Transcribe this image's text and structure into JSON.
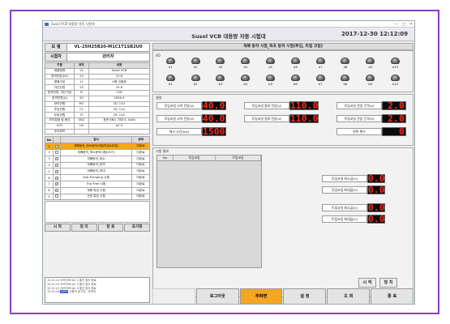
{
  "window": {
    "title": "Susol VCB 대용량 자동 시험대",
    "controls": [
      "—",
      "□",
      "✕"
    ]
  },
  "header": {
    "title": "Susol VCB 대용량 자동 시험대",
    "datetime": "2017-12-30  12:12:09"
  },
  "info": {
    "model_label": "모 델",
    "model_value": "VL-25H25B20-M1C1T1SB2U0",
    "operator_label": "시험자",
    "operator_value": "관리자"
  },
  "spec": {
    "headers": [
      "구분",
      "코드",
      "내용"
    ],
    "rows": [
      [
        "제품형명",
        "VL",
        "Susol VCB"
      ],
      [
        "정격전압(kV)",
        "25",
        "25.8"
      ],
      [
        "형별구분",
        "H",
        "H형 인출형"
      ],
      [
        "차단전류",
        "25",
        "25.8"
      ],
      [
        "정격전류, 차단구분",
        "B",
        "218"
      ],
      [
        "정격전류(A)",
        "20",
        "2000.0"
      ],
      [
        "모터전원",
        "M1",
        "DC 110"
      ],
      [
        "투입전원",
        "C1",
        "DC 110"
      ],
      [
        "트립전원",
        "T1",
        "DC 110"
      ],
      [
        "보조접점 및 배선",
        "SB2",
        "표준 8NO 기타(3, 4a4b"
      ],
      [
        "UVT",
        "U0",
        "AC 0"
      ],
      [
        "부속정보",
        "",
        ""
      ]
    ]
  },
  "tests": {
    "headers": [
      "No",
      "",
      "검사",
      "상태"
    ],
    "rows": [
      {
        "no": "1",
        "checked": true,
        "name": "개폐동작_최소동작시험(투입&트립)",
        "status": "미완료",
        "selected": true
      },
      {
        "no": "2",
        "checked": false,
        "name": "개폐동작_최소동작시험(UVT)",
        "status": "미완료",
        "selected": false
      },
      {
        "no": "3",
        "checked": true,
        "name": "개폐동작_최소",
        "status": "미완료",
        "selected": false
      },
      {
        "no": "4",
        "checked": true,
        "name": "개폐동작_정격",
        "status": "미완료",
        "selected": false
      },
      {
        "no": "5",
        "checked": true,
        "name": "개폐동작_최대",
        "status": "미완료",
        "selected": false
      },
      {
        "no": "6",
        "checked": true,
        "name": "Anti-Pumping 시험",
        "status": "미완료",
        "selected": false
      },
      {
        "no": "7",
        "checked": true,
        "name": "Trip Free 시험",
        "status": "미완료",
        "selected": false
      },
      {
        "no": "8",
        "checked": true,
        "name": "개폐 특성 시험",
        "status": "미완료",
        "selected": false
      },
      {
        "no": "9",
        "checked": false,
        "name": "규정 특성 시험",
        "status": "미완료",
        "selected": false
      }
    ]
  },
  "left_buttons": [
    "시 작",
    "정 지",
    "완 료",
    "초기화"
  ],
  "log": [
    {
      "time": "12:11:12",
      "src": "SYSTEM",
      "msg": "AC 2 통신 접속 완료"
    },
    {
      "time": "12:11:12",
      "src": "SYSTEM",
      "msg": "AC 3 통신 접속 완료"
    },
    {
      "time": "12:11:12",
      "src": "SYSTEM",
      "msg": "AC 4 통신 접속 완료"
    },
    {
      "time": "12:11:14",
      "src": "INFO",
      "msg": "사용자 로그인 : 관리자"
    }
  ],
  "test_title": "개폐 동작 시험_최초 동작 시험(투입, 트립 코일)",
  "io": {
    "label": "I/O",
    "row_a": [
      "a1",
      "a2",
      "a3",
      "a4",
      "a5",
      "a6",
      "a7",
      "a8",
      "a9",
      "a10"
    ],
    "row_b": [
      "b1",
      "b2",
      "b3",
      "b4",
      "b5",
      "b6",
      "b7",
      "b8",
      "b9",
      "b10"
    ]
  },
  "settings": {
    "caption": "설정",
    "params": [
      {
        "label": "투입코일 시작 전압(V)",
        "value": "40.0"
      },
      {
        "label": "트립코일 시작 전압(V)",
        "value": "40.0"
      },
      {
        "label": "체크 시간(ms)",
        "value": "1500"
      },
      {
        "label": "투입코일 종료 전압(V)",
        "value": "110.0"
      },
      {
        "label": "트립코일 종료 전압(V)",
        "value": "110.0"
      },
      {
        "label": "투입코일 전압 간격(V)",
        "value": "2.0"
      },
      {
        "label": "트립코일 전압 간격(V)",
        "value": "2.0"
      },
      {
        "label": "반복 횟수",
        "value": "0"
      }
    ]
  },
  "results": {
    "caption": "시험 결과",
    "headers": [
      "No",
      "투입코일",
      "트립코일"
    ],
    "params": [
      {
        "label": "투입코일 최소값(V)",
        "value": "0.0"
      },
      {
        "label": "투입코일 최대값(V)",
        "value": "0.0"
      },
      {
        "label": "트립코일 최소값(V)",
        "value": "0.0"
      },
      {
        "label": "트립코일 최대값(V)",
        "value": "0.0"
      }
    ],
    "start_label": "시 작",
    "stop_label": "정 지"
  },
  "bottom_nav": [
    "",
    "로그아웃",
    "주화면",
    "설 정",
    "조 회",
    "종 료"
  ],
  "colors": {
    "active": "#f5a623",
    "segment_text": "#ff2a1a",
    "segment_bg": "#0a0a0a",
    "frame": "#8a3cc6"
  }
}
